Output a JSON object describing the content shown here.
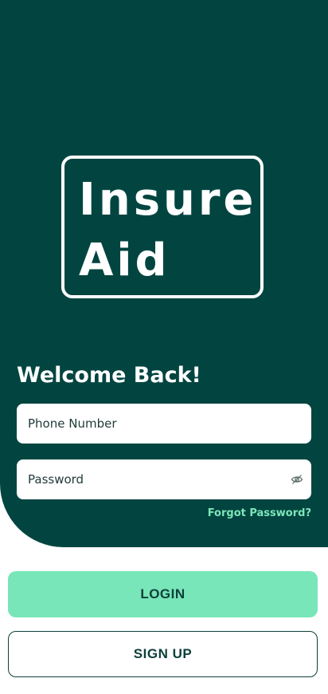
{
  "logo": {
    "line1": "Insure",
    "line2": "Aid"
  },
  "login_form": {
    "heading": "Welcome Back!",
    "phone_placeholder": "Phone Number",
    "password_placeholder": "Password",
    "forgot_password": "Forgot Password?"
  },
  "actions": {
    "login_label": "LOGIN",
    "signup_label": "SIGN UP"
  },
  "icons": {
    "password_toggle": "eye-off-icon"
  },
  "colors": {
    "brand_dark": "#024540",
    "accent_green": "#78e6b8",
    "link_green": "#7de6b9",
    "text_dark": "#0d3f3a"
  }
}
